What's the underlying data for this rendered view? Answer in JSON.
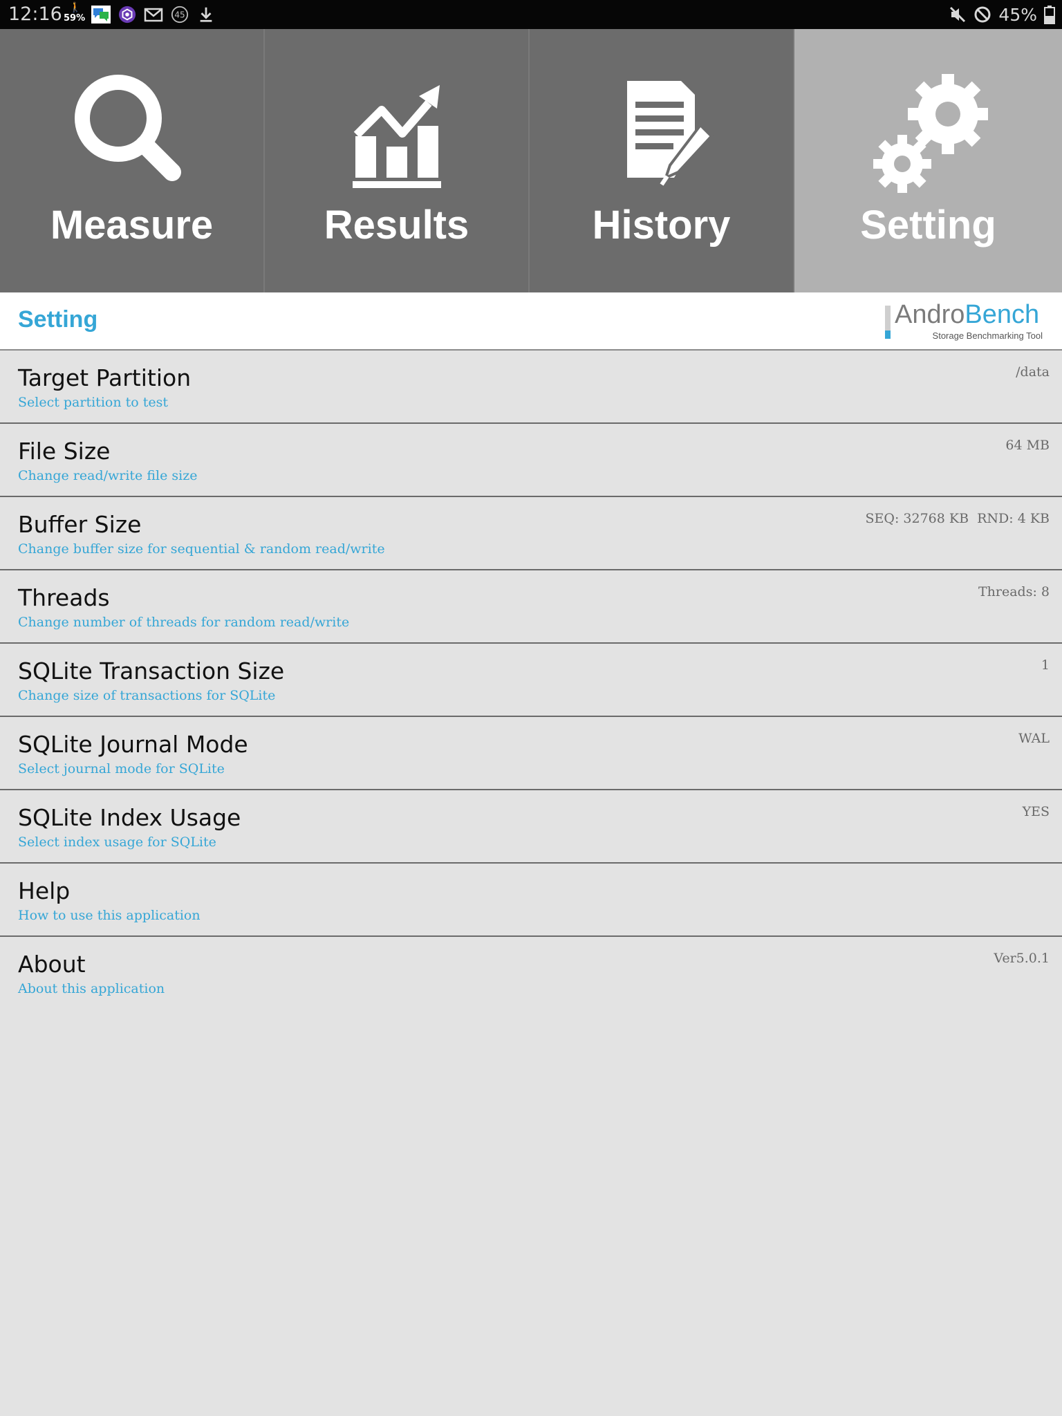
{
  "status_bar": {
    "time": "12:16",
    "steps_percent": "59%",
    "badge_count": "45",
    "battery": "45%"
  },
  "tabs": [
    {
      "label": "Measure",
      "icon": "search-icon",
      "active": false
    },
    {
      "label": "Results",
      "icon": "chart-icon",
      "active": false
    },
    {
      "label": "History",
      "icon": "document-edit-icon",
      "active": false
    },
    {
      "label": "Setting",
      "icon": "gears-icon",
      "active": true
    }
  ],
  "header": {
    "title": "Setting",
    "logo_andro": "Andro",
    "logo_bench": "Bench",
    "logo_sub": "Storage Benchmarking Tool"
  },
  "settings": [
    {
      "title": "Target Partition",
      "subtitle": "Select partition to test",
      "value": "/data"
    },
    {
      "title": "File Size",
      "subtitle": "Change read/write file size",
      "value": "64 MB"
    },
    {
      "title": "Buffer Size",
      "subtitle": "Change buffer size for sequential & random read/write",
      "value": "SEQ: 32768 KB  RND: 4 KB"
    },
    {
      "title": "Threads",
      "subtitle": "Change number of threads for random read/write",
      "value": "Threads: 8"
    },
    {
      "title": "SQLite Transaction Size",
      "subtitle": "Change size of transactions for SQLite",
      "value": "1"
    },
    {
      "title": "SQLite Journal Mode",
      "subtitle": "Select journal mode for SQLite",
      "value": "WAL"
    },
    {
      "title": "SQLite Index Usage",
      "subtitle": "Select index usage for SQLite",
      "value": "YES"
    },
    {
      "title": "Help",
      "subtitle": "How to use this application",
      "value": ""
    },
    {
      "title": "About",
      "subtitle": "About this application",
      "value": "Ver5.0.1"
    }
  ],
  "colors": {
    "accent": "#35a6d6",
    "tab_bg": "#6c6c6c",
    "tab_active_bg": "#b1b1b1",
    "list_bg": "#e3e3e3"
  }
}
